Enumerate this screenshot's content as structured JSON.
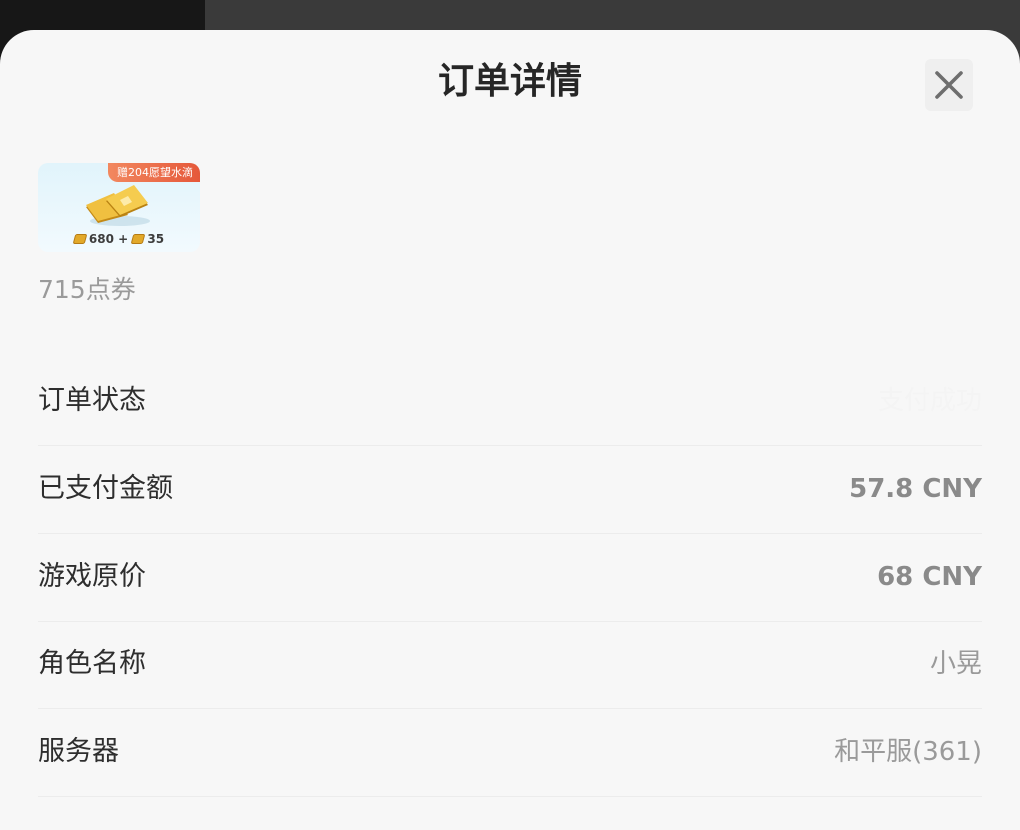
{
  "dialog": {
    "title": "订单详情",
    "close_icon": "close-icon"
  },
  "product": {
    "promo_tag": "赠204愿望水滴",
    "base_count": "680",
    "plus": "+",
    "bonus_count": "35",
    "name": "715点券",
    "image_icon": "gold-coupon-stack-icon"
  },
  "details": {
    "order_status": {
      "label": "订单状态",
      "value": "支付成功"
    },
    "paid_amount": {
      "label": "已支付金额",
      "value": "57.8 CNY"
    },
    "original_price": {
      "label": "游戏原价",
      "value": "68 CNY"
    },
    "role_name": {
      "label": "角色名称",
      "value": "小晃"
    },
    "server": {
      "label": "服务器",
      "value": "和平服(361)"
    }
  },
  "colors": {
    "sheet_background": "#f7f7f7",
    "promo_tag": "#e96a45",
    "gold": "#e2a92a"
  }
}
